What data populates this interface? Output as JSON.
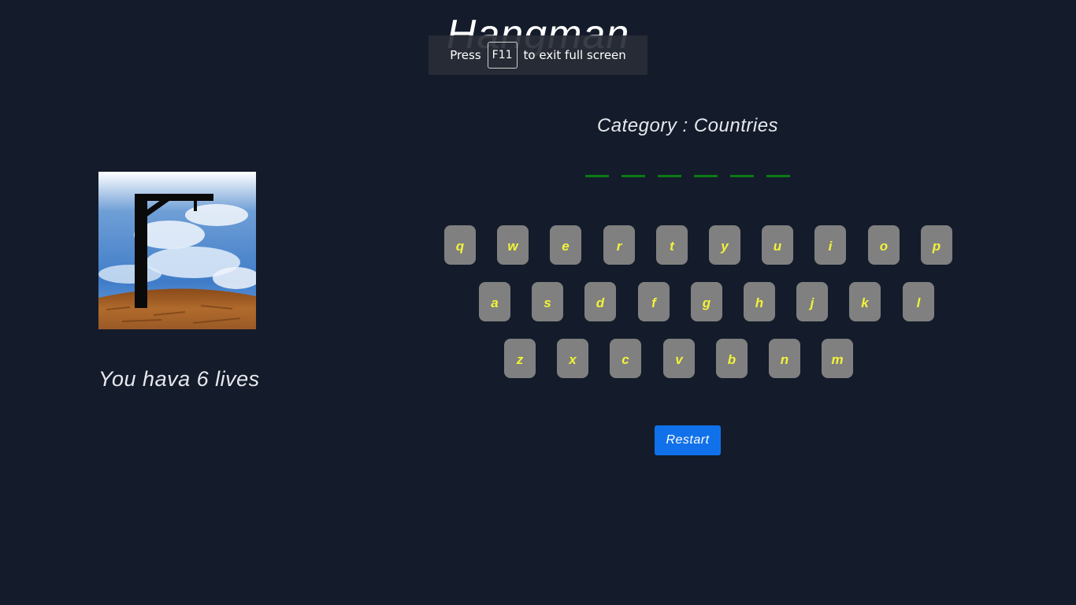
{
  "title": "Hangman",
  "fullscreen_notice": {
    "before": "Press",
    "key": "F11",
    "after": "to exit full screen"
  },
  "lives_text": "You hava 6 lives",
  "category_text": "Category : Countries",
  "word_slot_count": 6,
  "keyboard": {
    "row1": [
      "q",
      "w",
      "e",
      "r",
      "t",
      "y",
      "u",
      "i",
      "o",
      "p"
    ],
    "row2": [
      "a",
      "s",
      "d",
      "f",
      "g",
      "h",
      "j",
      "k",
      "l"
    ],
    "row3": [
      "z",
      "x",
      "c",
      "v",
      "b",
      "n",
      "m"
    ]
  },
  "restart_label": "Restart",
  "colors": {
    "background": "#141c2b",
    "key_bg": "#808080",
    "key_text": "#f2f23a",
    "word_slot": "#0a7a14",
    "restart_bg": "#1171ea"
  },
  "image": "gallows-scene"
}
